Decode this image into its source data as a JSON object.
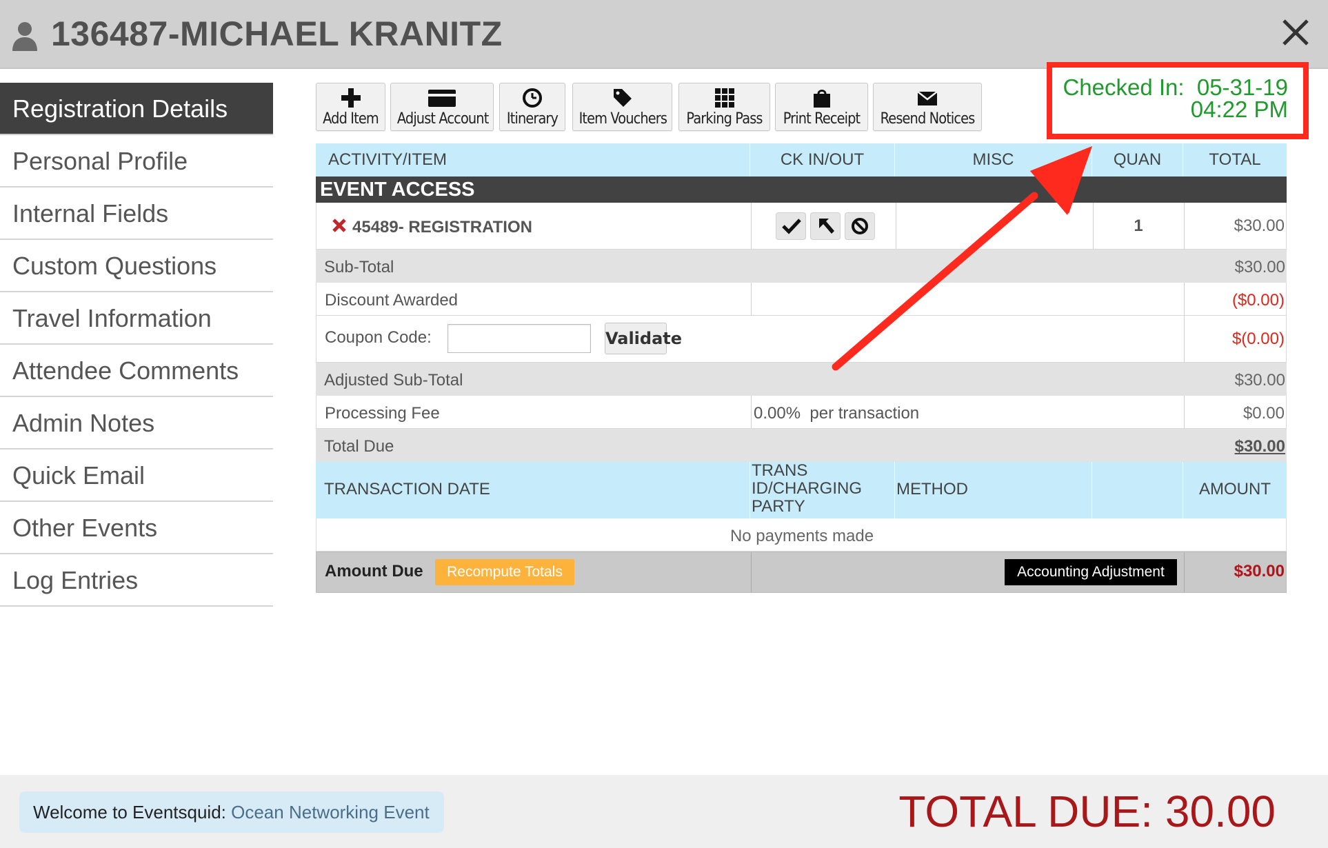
{
  "header": {
    "title": "136487-MICHAEL KRANITZ",
    "icon": "user-icon",
    "close_icon": "close-icon"
  },
  "sidebar": {
    "items": [
      {
        "label": "Registration Details",
        "active": true
      },
      {
        "label": "Personal Profile"
      },
      {
        "label": "Internal Fields"
      },
      {
        "label": "Custom Questions"
      },
      {
        "label": "Travel Information"
      },
      {
        "label": "Attendee Comments"
      },
      {
        "label": "Admin Notes"
      },
      {
        "label": "Quick Email"
      },
      {
        "label": "Other Events"
      },
      {
        "label": "Log Entries"
      }
    ]
  },
  "toolbar": {
    "buttons": [
      {
        "label": "Add Item",
        "icon": "plus-icon"
      },
      {
        "label": "Adjust Account",
        "icon": "credit-card-icon"
      },
      {
        "label": "Itinerary",
        "icon": "clock-icon"
      },
      {
        "label": "Item Vouchers",
        "icon": "tag-icon"
      },
      {
        "label": "Parking Pass",
        "icon": "grid-icon"
      },
      {
        "label": "Print Receipt",
        "icon": "shopping-bag-icon"
      },
      {
        "label": "Resend Notices",
        "icon": "envelope-icon"
      }
    ]
  },
  "checkin": {
    "label": "Checked In:",
    "date": "05-31-19",
    "time": "04:22 PM",
    "highlight_color": "#ff2a1e",
    "text_color": "#1f9a2c"
  },
  "table": {
    "headers": {
      "activity": "ACTIVITY/ITEM",
      "ckinout": "CK IN/OUT",
      "misc": "MISC",
      "quan": "QUAN",
      "total": "TOTAL"
    },
    "section": "EVENT ACCESS",
    "item": {
      "name": "45489- REGISTRATION",
      "quantity": "1",
      "total": "$30.00",
      "actions": [
        "check-icon",
        "arrow-up-left-icon",
        "ban-icon"
      ]
    },
    "subtotal": {
      "label": "Sub-Total",
      "value": "$30.00"
    },
    "discount": {
      "label": "Discount Awarded",
      "value": "($0.00)"
    },
    "coupon": {
      "label": "Coupon Code:",
      "value": "",
      "button": "Validate",
      "amount": "$(0.00)"
    },
    "adjusted_subtotal": {
      "label": "Adjusted Sub-Total",
      "value": "$30.00"
    },
    "processing_fee": {
      "label": "Processing Fee",
      "rate": "0.00%  per transaction",
      "value": "$0.00"
    },
    "total_due": {
      "label": "Total Due",
      "value": "$30.00"
    },
    "transactions": {
      "headers": {
        "date": "TRANSACTION DATE",
        "trans_line1": "TRANS",
        "trans_line2": "ID/CHARGING",
        "trans_line3": "PARTY",
        "method": "METHOD",
        "amount": "AMOUNT"
      },
      "empty_message": "No payments made"
    },
    "amount_due": {
      "label": "Amount Due",
      "recompute": "Recompute Totals",
      "accounting": "Accounting Adjustment",
      "value": "$30.00"
    }
  },
  "footer": {
    "welcome_label": "Welcome to Eventsquid:",
    "event_name": "Ocean Networking Event",
    "total_due": "TOTAL DUE: 30.00"
  },
  "colors": {
    "header_bg": "#d0d0d0",
    "table_header_bg": "#c6ecfb",
    "section_bg": "#424242",
    "recompute_bg": "#fdb33b",
    "total_due_color": "#a8171a",
    "arrow_color": "#ff2a1e"
  }
}
